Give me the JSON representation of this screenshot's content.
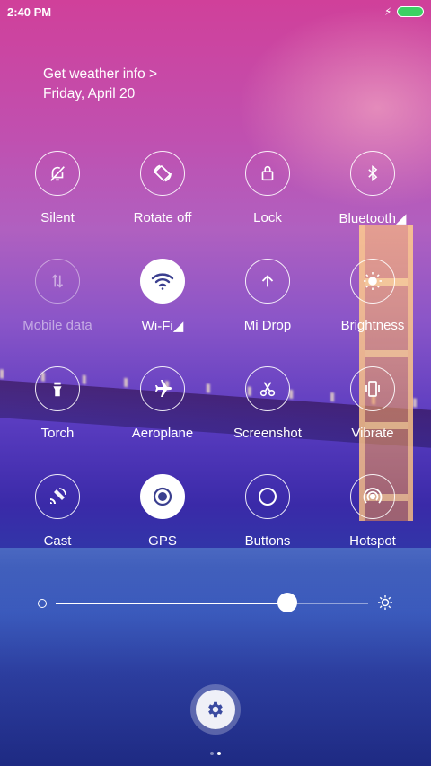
{
  "status_bar": {
    "time": "2:40 PM",
    "battery_color": "#3bd163"
  },
  "weather": {
    "line1": "Get weather info >",
    "line2": "Friday, April 20"
  },
  "tiles": [
    {
      "label": "Silent",
      "icon": "bell-off-icon",
      "state": "off"
    },
    {
      "label": "Rotate off",
      "icon": "rotate-icon",
      "state": "off"
    },
    {
      "label": "Lock",
      "icon": "lock-icon",
      "state": "off"
    },
    {
      "label": "Bluetooth◢",
      "icon": "bluetooth-icon",
      "state": "off"
    },
    {
      "label": "Mobile data",
      "icon": "mobile-data-icon",
      "state": "disabled"
    },
    {
      "label": "Wi-Fi◢",
      "icon": "wifi-icon",
      "state": "on"
    },
    {
      "label": "Mi Drop",
      "icon": "mi-drop-icon",
      "state": "off"
    },
    {
      "label": "Brightness",
      "icon": "brightness-icon",
      "state": "off"
    },
    {
      "label": "Torch",
      "icon": "torch-icon",
      "state": "off"
    },
    {
      "label": "Aeroplane",
      "icon": "aeroplane-icon",
      "state": "off"
    },
    {
      "label": "Screenshot",
      "icon": "scissors-icon",
      "state": "off"
    },
    {
      "label": "Vibrate",
      "icon": "vibrate-icon",
      "state": "off"
    },
    {
      "label": "Cast",
      "icon": "cast-icon",
      "state": "off"
    },
    {
      "label": "GPS",
      "icon": "gps-icon",
      "state": "on"
    },
    {
      "label": "Buttons",
      "icon": "buttons-icon",
      "state": "off"
    },
    {
      "label": "Hotspot",
      "icon": "hotspot-icon",
      "state": "off"
    }
  ],
  "brightness_slider": {
    "value_fraction": 0.74
  },
  "page_indicator": {
    "count": 2,
    "active": 1
  }
}
